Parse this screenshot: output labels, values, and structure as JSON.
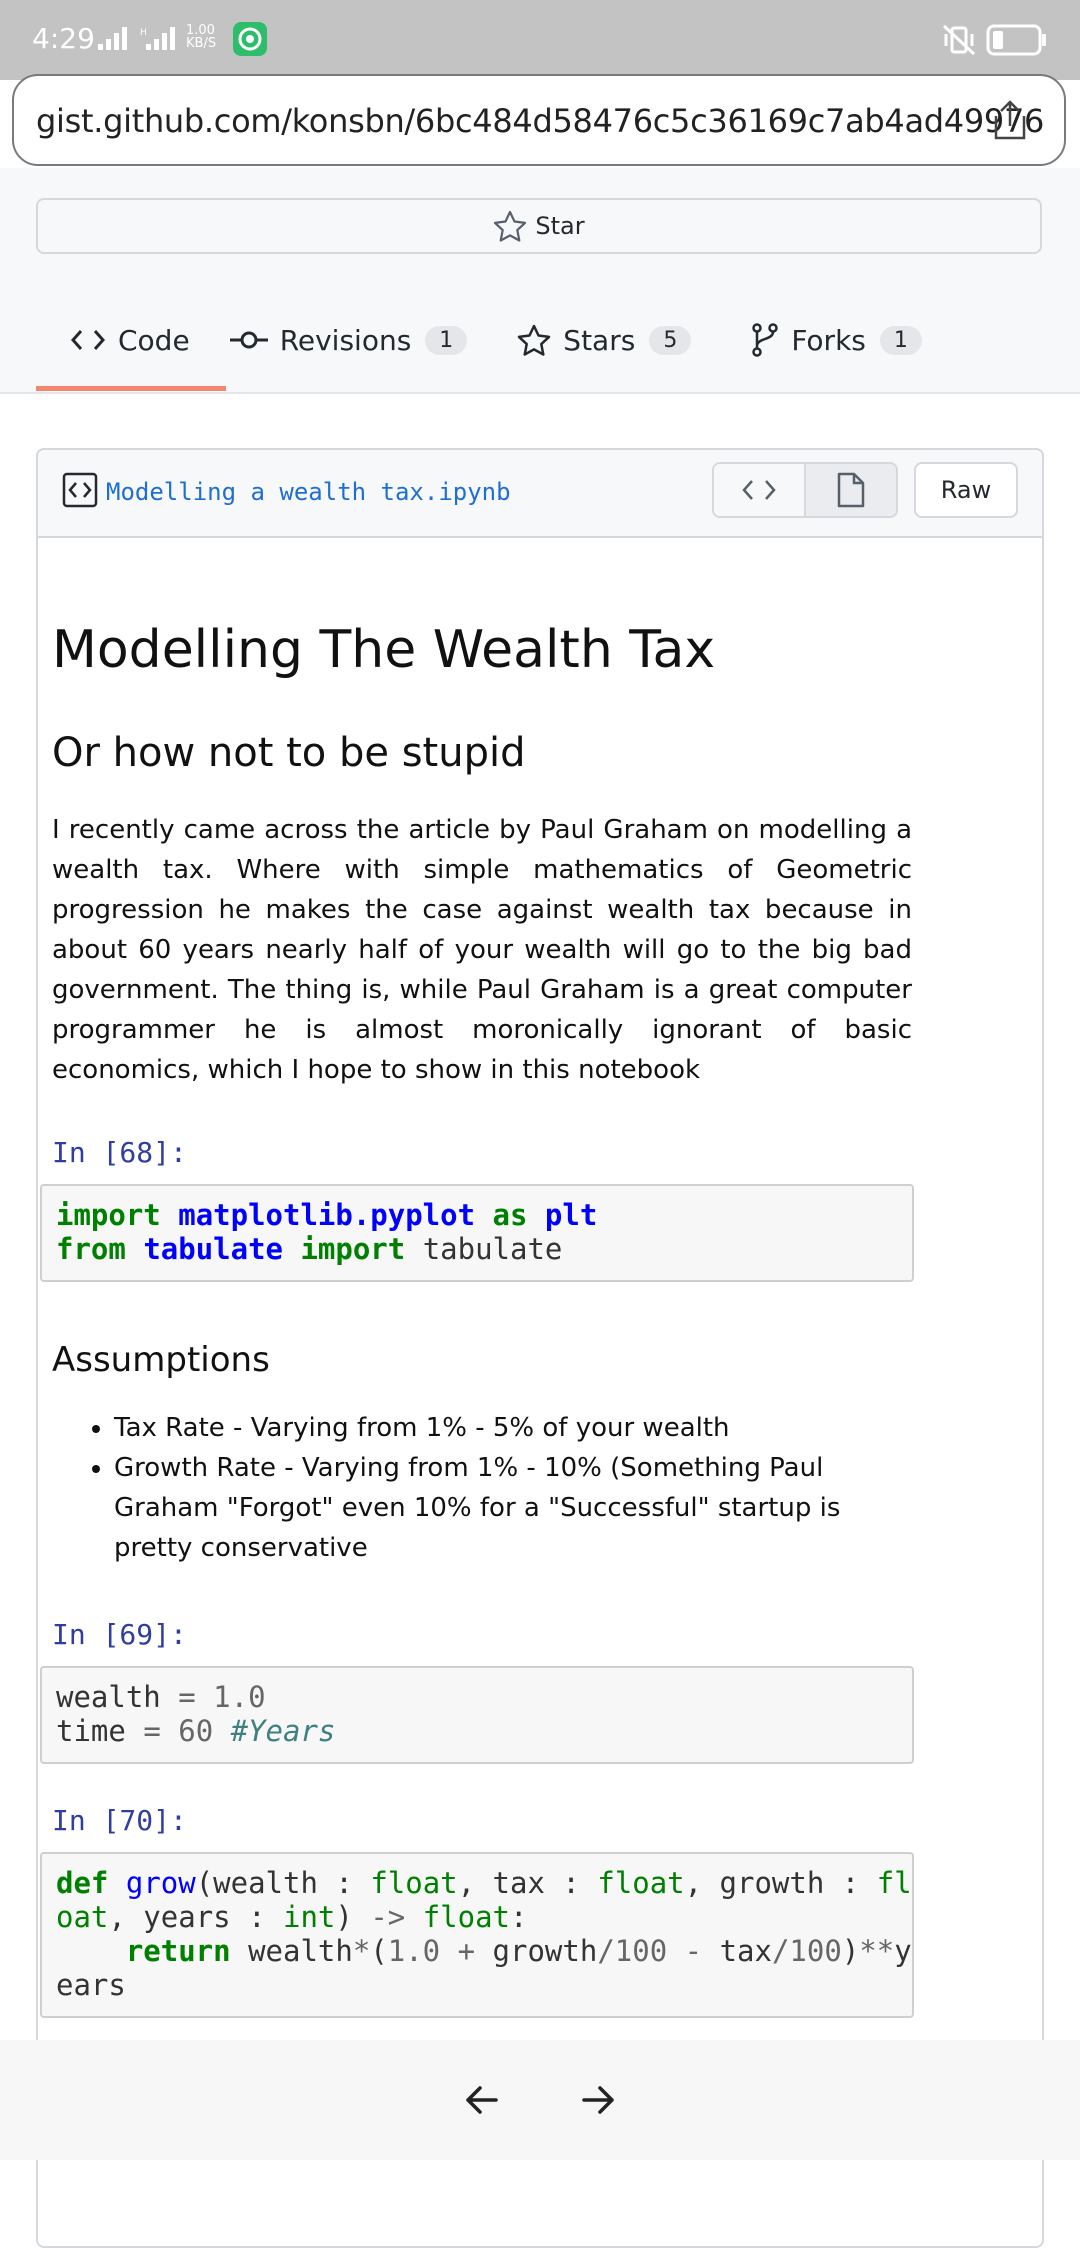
{
  "status_bar": {
    "time": "4:29",
    "net_speed_value": "1.00",
    "net_speed_unit": "KB/S"
  },
  "browser": {
    "url": "gist.github.com/konsbn/6bc484d58476c5c36169c7ab4ad49976"
  },
  "gist": {
    "star_label": "Star",
    "tabs": [
      {
        "label": "Code",
        "count": ""
      },
      {
        "label": "Revisions",
        "count": "1"
      },
      {
        "label": "Stars",
        "count": "5"
      },
      {
        "label": "Forks",
        "count": "1"
      }
    ],
    "file_name": "Modelling a wealth tax.ipynb",
    "raw_label": "Raw"
  },
  "notebook": {
    "title": "Modelling The Wealth Tax",
    "subtitle": "Or how not to be stupid",
    "intro": "I recently came across the article by Paul Graham on modelling a wealth tax. Where with simple mathematics of Geometric progression he makes the case against wealth tax because in about 60 years nearly half of your wealth will go to the big bad government. The thing is, while Paul Graham is a great computer programmer he is almost moronically ignorant of basic economics, which I hope to show in this notebook",
    "prompt1": "In [68]:",
    "prompt2": "In [69]:",
    "prompt3": "In [70]:",
    "assumptions_heading": "Assumptions",
    "assumptions": [
      "Tax Rate - Varying from 1% - 5% of your wealth",
      "Growth Rate - Varying from 1% - 10% (Something Paul Graham \"Forgot\" even 10% for a \"Successful\" startup is pretty conservative"
    ]
  }
}
